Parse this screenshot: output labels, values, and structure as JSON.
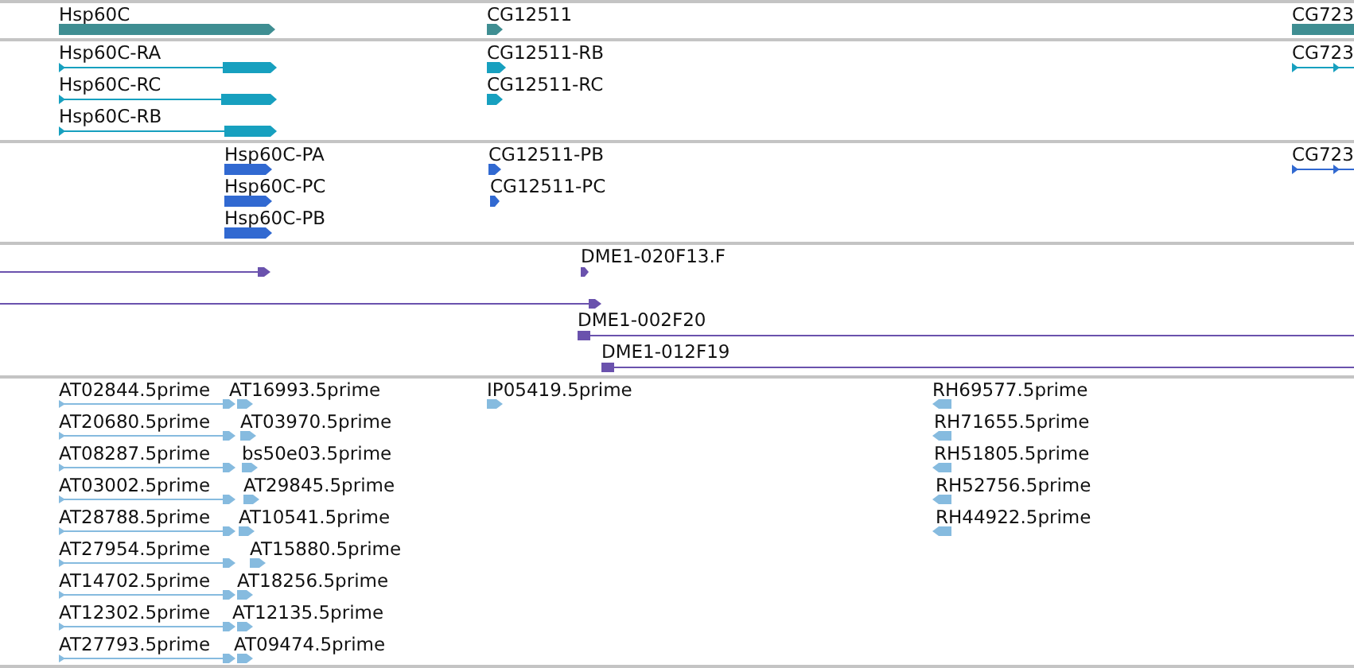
{
  "tracks": [
    {
      "kind": "gene",
      "features": [
        {
          "label": "Hsp60C"
        },
        {
          "label": "CG12511"
        },
        {
          "label": "CG723"
        }
      ]
    },
    {
      "kind": "transcript",
      "features": [
        {
          "label": "Hsp60C-RA"
        },
        {
          "label": "Hsp60C-RC"
        },
        {
          "label": "Hsp60C-RB"
        },
        {
          "label": "CG12511-RB"
        },
        {
          "label": "CG12511-RC"
        },
        {
          "label": "CG723"
        }
      ]
    },
    {
      "kind": "protein",
      "features": [
        {
          "label": "Hsp60C-PA"
        },
        {
          "label": "Hsp60C-PC"
        },
        {
          "label": "Hsp60C-PB"
        },
        {
          "label": "CG12511-PB"
        },
        {
          "label": "CG12511-PC"
        },
        {
          "label": "CG723"
        }
      ]
    },
    {
      "kind": "clone",
      "features": [
        {
          "reverse": false
        },
        {
          "label": "DME1-020F13.F",
          "reverse": false
        },
        {
          "reverse": false
        },
        {
          "label": "DME1-002F20",
          "reverse": false
        },
        {
          "label": "DME1-012F19",
          "reverse": false
        }
      ]
    },
    {
      "kind": "est",
      "features": [
        {
          "label": "AT02844.5prime",
          "reverse": false
        },
        {
          "label": "AT16993.5prime",
          "reverse": false
        },
        {
          "label": "IP05419.5prime",
          "reverse": false
        },
        {
          "label": "RH69577.5prime",
          "reverse": true
        },
        {
          "label": "AT20680.5prime",
          "reverse": false
        },
        {
          "label": "AT03970.5prime",
          "reverse": false
        },
        {
          "label": "RH71655.5prime",
          "reverse": true
        },
        {
          "label": "AT08287.5prime",
          "reverse": false
        },
        {
          "label": "bs50e03.5prime",
          "reverse": false
        },
        {
          "label": "RH51805.5prime",
          "reverse": true
        },
        {
          "label": "AT03002.5prime",
          "reverse": false
        },
        {
          "label": "AT29845.5prime",
          "reverse": false
        },
        {
          "label": "RH52756.5prime",
          "reverse": true
        },
        {
          "label": "AT28788.5prime",
          "reverse": false
        },
        {
          "label": "AT10541.5prime",
          "reverse": false
        },
        {
          "label": "RH44922.5prime",
          "reverse": true
        },
        {
          "label": "AT27954.5prime",
          "reverse": false
        },
        {
          "label": "AT15880.5prime",
          "reverse": false
        },
        {
          "label": "AT14702.5prime",
          "reverse": false
        },
        {
          "label": "AT18256.5prime",
          "reverse": false
        },
        {
          "label": "AT12302.5prime",
          "reverse": false
        },
        {
          "label": "AT12135.5prime",
          "reverse": false
        },
        {
          "label": "AT27793.5prime",
          "reverse": false
        },
        {
          "label": "AT09474.5prime",
          "reverse": false
        }
      ]
    }
  ]
}
